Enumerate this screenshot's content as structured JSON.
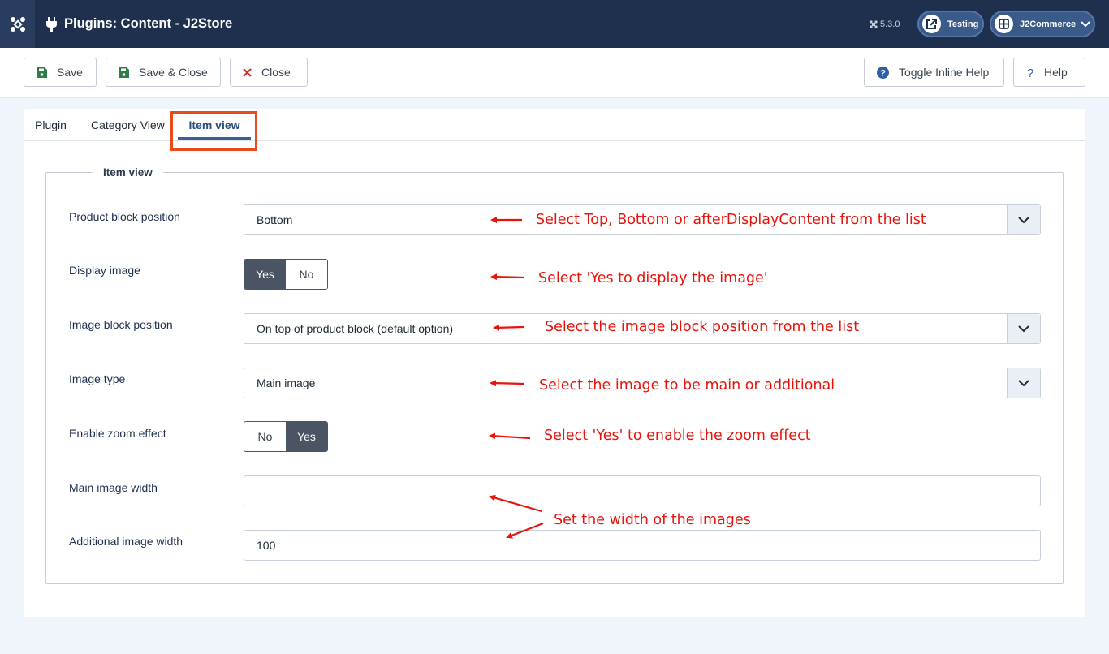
{
  "header": {
    "title": "Plugins: Content - J2Store",
    "version": "5.3.0",
    "testing_label": "Testing",
    "user_label": "J2Commerce"
  },
  "toolbar": {
    "save_label": "Save",
    "save_close_label": "Save & Close",
    "close_label": "Close",
    "toggle_help_label": "Toggle Inline Help",
    "help_label": "Help"
  },
  "tabs": [
    {
      "label": "Plugin"
    },
    {
      "label": "Category View"
    },
    {
      "label": "Item view",
      "active": true
    }
  ],
  "fieldset": {
    "legend": "Item view",
    "fields": {
      "product_block_position": {
        "label": "Product block position",
        "value": "Bottom"
      },
      "display_image": {
        "label": "Display image",
        "options": [
          "Yes",
          "No"
        ],
        "selected": "Yes"
      },
      "image_block_position": {
        "label": "Image block position",
        "value": "On top of product block (default option)"
      },
      "image_type": {
        "label": "Image type",
        "value": "Main image"
      },
      "enable_zoom": {
        "label": "Enable zoom effect",
        "options": [
          "No",
          "Yes"
        ],
        "selected": "Yes"
      },
      "main_image_width": {
        "label": "Main image width",
        "value": ""
      },
      "additional_image_width": {
        "label": "Additional image width",
        "value": "100"
      }
    }
  },
  "annotations": {
    "product_block": "Select Top, Bottom or afterDisplayContent from the list",
    "display_image": "Select 'Yes to display the image'",
    "image_block": "Select the image block position from the list",
    "image_type": "Select the image to be main or additional",
    "zoom": "Select 'Yes' to enable the zoom effect",
    "width": "Set the width of the images"
  },
  "colors": {
    "header_bg": "#1f304e",
    "annotation": "#e8140c",
    "tab_highlight": "#e94b1b",
    "toggle_active": "#4a5462"
  }
}
